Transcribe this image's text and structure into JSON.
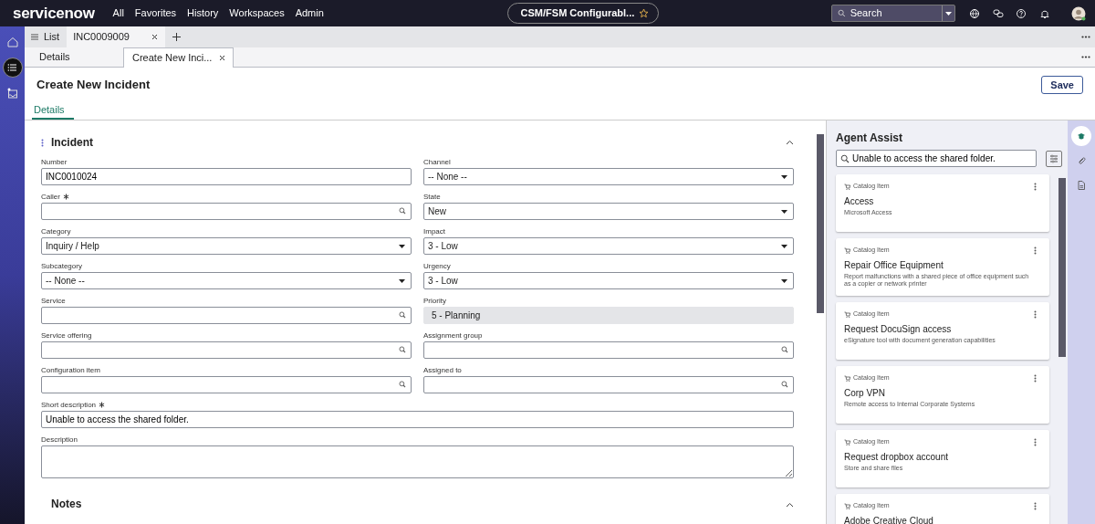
{
  "top_nav": {
    "logo": "servicenow",
    "menu": [
      "All",
      "Favorites",
      "History",
      "Workspaces",
      "Admin"
    ],
    "context_pill": "CSM/FSM Configurabl...",
    "search": {
      "placeholder": "Search"
    }
  },
  "left_rail": [
    {
      "selected": false
    },
    {
      "selected": true
    },
    {
      "selected": false
    }
  ],
  "workspace_tabs": [
    {
      "label": "List",
      "selected": false,
      "closable": false
    },
    {
      "label": "INC0009009",
      "selected": true,
      "closable": true
    }
  ],
  "record_tabs": [
    {
      "label": "Details",
      "selected": false,
      "closable": false
    },
    {
      "label": "Create New Inci...",
      "selected": true,
      "closable": true
    }
  ],
  "page": {
    "title": "Create New Incident",
    "save_button": "Save",
    "form_tabs": [
      {
        "label": "Details",
        "selected": true
      }
    ]
  },
  "sections": [
    {
      "title": "Incident",
      "expanded": true,
      "left_fields": [
        {
          "label": "Number",
          "kind": "text",
          "value": "INC0010024",
          "required": false
        },
        {
          "label": "Caller",
          "kind": "lookup",
          "required": true
        },
        {
          "label": "Category",
          "kind": "select",
          "value": "Inquiry / Help",
          "required": false
        },
        {
          "label": "Subcategory",
          "kind": "select",
          "value": "-- None --",
          "required": false
        },
        {
          "label": "Service",
          "kind": "lookup",
          "required": false
        },
        {
          "label": "Service offering",
          "kind": "lookup",
          "required": false
        },
        {
          "label": "Configuration item",
          "kind": "lookup",
          "required": false
        }
      ],
      "right_fields": [
        {
          "label": "Channel",
          "kind": "select",
          "value": "-- None --",
          "required": false
        },
        {
          "label": "State",
          "kind": "select",
          "value": "New",
          "required": false
        },
        {
          "label": "Impact",
          "kind": "select",
          "value": "3 - Low",
          "required": false
        },
        {
          "label": "Urgency",
          "kind": "select",
          "value": "3 - Low",
          "required": false
        },
        {
          "label": "Priority",
          "kind": "readonly",
          "value": "5 - Planning",
          "required": false
        },
        {
          "label": "Assignment group",
          "kind": "lookup",
          "required": false
        },
        {
          "label": "Assigned to",
          "kind": "lookup",
          "required": false
        }
      ],
      "full_fields": [
        {
          "label": "Short description",
          "kind": "text",
          "value": "Unable to access the shared folder.",
          "required": true
        },
        {
          "label": "Description",
          "kind": "textarea",
          "required": false
        }
      ]
    },
    {
      "title": "Notes",
      "expanded": true
    }
  ],
  "agent_assist": {
    "title": "Agent Assist",
    "search": {
      "value": "Unable to access the shared folder."
    },
    "results": [
      {
        "type": "Catalog Item",
        "title": "Access",
        "description": "Microsoft Access"
      },
      {
        "type": "Catalog Item",
        "title": "Repair Office Equipment",
        "description": "Report malfunctions with a shared piece of office equipment such as a copier or network printer"
      },
      {
        "type": "Catalog Item",
        "title": "Request DocuSign access",
        "description": "eSignature tool with document generation capabilities"
      },
      {
        "type": "Catalog Item",
        "title": "Corp VPN",
        "description": "Remote access to Internal Corporate Systems"
      },
      {
        "type": "Catalog Item",
        "title": "Request dropbox account",
        "description": "Store and share files"
      },
      {
        "type": "Catalog Item",
        "title": "Adobe Creative Cloud"
      }
    ]
  },
  "right_rail": [
    {
      "selected": true
    },
    {
      "selected": false
    },
    {
      "selected": false
    }
  ]
}
